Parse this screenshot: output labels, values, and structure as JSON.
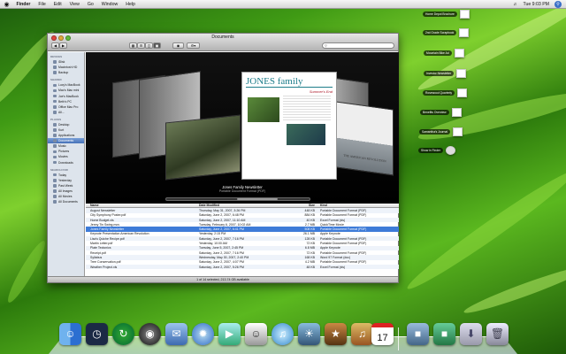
{
  "menubar": {
    "apple": "",
    "app": "Finder",
    "items": [
      "File",
      "Edit",
      "View",
      "Go",
      "Window",
      "Help"
    ],
    "clock": "Tue 9:03 PM"
  },
  "window": {
    "title": "Documents",
    "search_placeholder": ""
  },
  "sidebar": {
    "devices_header": "DEVICES",
    "devices": [
      "iDisk",
      "Macintosh HD",
      "Backup"
    ],
    "shared_header": "SHARED",
    "shared": [
      "Lucy's MacBook",
      "Mac's Mac mini",
      "Joe's MacBook",
      "Beth's PC",
      "Office Mac Pro",
      "All..."
    ],
    "places_header": "PLACES",
    "places": [
      "Desktop",
      "Kurt",
      "Applications",
      "Documents",
      "Music",
      "Pictures",
      "Movies",
      "Downloads"
    ],
    "search_header": "SEARCH FOR",
    "search": [
      "Today",
      "Yesterday",
      "Past Week",
      "All Images",
      "All Movies",
      "All Documents"
    ]
  },
  "coverflow": {
    "title": "Jones Family Newsletter",
    "subtitle": "Portable Document Format (PDF)",
    "doc_heading": "JONES family",
    "doc_sub": "Summer's End",
    "right_card_text": "THE AMERICAN REVOLUTION"
  },
  "list": {
    "headers": [
      "Name",
      "Date Modified",
      "Size",
      "Kind"
    ],
    "rows": [
      [
        "August Newsletter",
        "Thursday, May 31, 2007, 3:26 PM",
        "448 KB",
        "Portable Document Format (PDF)"
      ],
      [
        "City Symphony Poster.pdf",
        "Saturday, June 2, 2007, 6:48 PM",
        "884 KB",
        "Portable Document Format (PDF)"
      ],
      [
        "Home Budget.xls",
        "Saturday, June 2, 2007, 11:10 AM",
        "40 KB",
        "Excel Format (xls)"
      ],
      [
        "Jenny Tin Swing.mov",
        "Tuesday, February 6, 2007, 10:02 AM",
        "2.7 MB",
        "QuickTime Movie"
      ],
      [
        "Jones Family Newsletter",
        "Saturday, June 2, 2007, 6:41 PM",
        "508 KB",
        "Portable Document Format (PDF)"
      ],
      [
        "Keynote Presentation American Revolution",
        "Yesterday, 2:15 PM",
        "26.1 MB",
        "Apple Keynote"
      ],
      [
        "Lisa's Quiche Recipe.pdf",
        "Saturday, June 2, 2007, 7:16 PM",
        "128 KB",
        "Portable Document Format (PDF)"
      ],
      [
        "Martin Letter.pdf",
        "Yesterday, 10:00 AM",
        "72 KB",
        "Portable Document Format (PDF)"
      ],
      [
        "Plate Tectonics",
        "Tuesday, June 5, 2007, 2:45 PM",
        "6.8 MB",
        "Apple Keynote"
      ],
      [
        "Receipt.pdf",
        "Saturday, June 2, 2007, 7:16 PM",
        "72 KB",
        "Portable Document Format (PDF)"
      ],
      [
        "Syllabus",
        "Wednesday, May 30, 2007, 2:40 PM",
        "168 KB",
        "Word 97 Format (doc)"
      ],
      [
        "Tree Conservation.pdf",
        "Saturday, June 2, 2007, 4:07 PM",
        "4.2 MB",
        "Portable Document Format (PDF)"
      ],
      [
        "Weather Project.xls",
        "Saturday, June 2, 2007, 5:26 PM",
        "48 KB",
        "Excel Format (xls)"
      ]
    ],
    "selected_index": 4
  },
  "status": "1 of 14 selected, 213.74 GB available",
  "stack": [
    "Home Depot Brochure",
    "2nd Grade Scrapbook",
    "Mountain Bike Ad",
    "Investor Newsletter",
    "Rosewood Quarterly",
    "Benefits Overview",
    "Samantha's Journal",
    "Show in Finder"
  ],
  "dock": {
    "ical_day": "17"
  }
}
